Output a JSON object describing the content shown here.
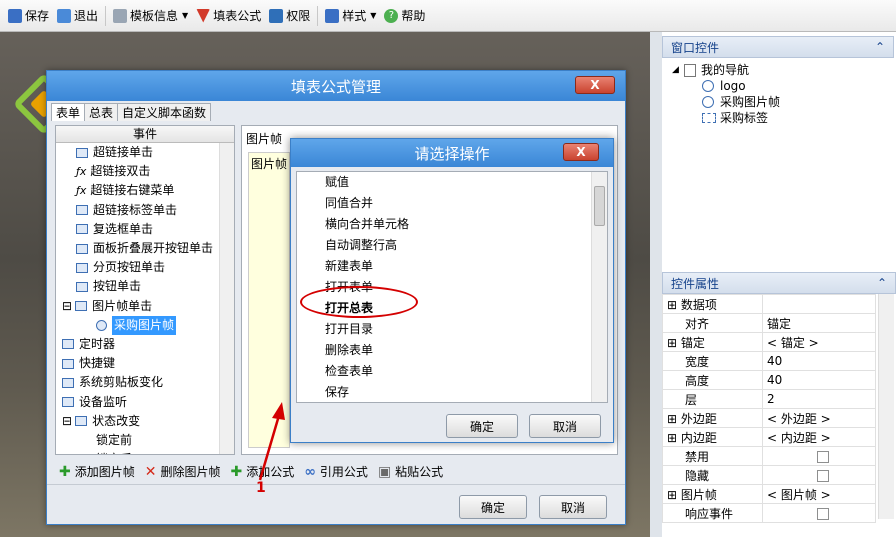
{
  "toolbar": {
    "save": "保存",
    "exit": "退出",
    "template_info": "模板信息",
    "fill_formula": "填表公式",
    "permission": "权限",
    "style": "样式",
    "help": "帮助"
  },
  "right_panel": {
    "window_controls_title": "窗口控件",
    "nav_root": "我的导航",
    "nav_children": [
      "logo",
      "采购图片帧",
      "采购标签"
    ],
    "props_title": "控件属性",
    "props": [
      {
        "k": "数据项",
        "v": "",
        "expand": true
      },
      {
        "k": "对齐",
        "v": "锚定",
        "expand": false
      },
      {
        "k": "锚定",
        "v": "< 锚定 >",
        "expand": true
      },
      {
        "k": "宽度",
        "v": "40",
        "expand": false
      },
      {
        "k": "高度",
        "v": "40",
        "expand": false
      },
      {
        "k": "层",
        "v": "2",
        "expand": false
      },
      {
        "k": "外边距",
        "v": "< 外边距 >",
        "expand": true
      },
      {
        "k": "内边距",
        "v": "< 内边距 >",
        "expand": true
      },
      {
        "k": "禁用",
        "v": "",
        "checkbox": true,
        "expand": false
      },
      {
        "k": "隐藏",
        "v": "",
        "checkbox": true,
        "expand": false
      },
      {
        "k": "图片帧",
        "v": "< 图片帧 >",
        "expand": true
      },
      {
        "k": "响应事件",
        "v": "",
        "checkbox": true,
        "expand": false
      }
    ]
  },
  "main_dialog": {
    "title": "填表公式管理",
    "close": "X",
    "tabs": [
      "表单",
      "总表",
      "自定义脚本函数"
    ],
    "events_header": "事件",
    "events": [
      {
        "label": "超链接单击",
        "icon": "grid",
        "indent": 1
      },
      {
        "label": "超链接双击",
        "icon": "fx",
        "indent": 1
      },
      {
        "label": "超链接右键菜单",
        "icon": "fx",
        "indent": 1
      },
      {
        "label": "超链接标签单击",
        "icon": "grid",
        "indent": 1
      },
      {
        "label": "复选框单击",
        "icon": "grid",
        "indent": 1
      },
      {
        "label": "面板折叠展开按钮单击",
        "icon": "grid",
        "indent": 1
      },
      {
        "label": "分页按钮单击",
        "icon": "grid",
        "indent": 1
      },
      {
        "label": "按钮单击",
        "icon": "grid",
        "indent": 1
      },
      {
        "label": "图片帧单击",
        "icon": "grid",
        "indent": 0,
        "expanded": true
      },
      {
        "label": "采购图片帧",
        "icon": "play",
        "indent": 2,
        "selected": true
      },
      {
        "label": "定时器",
        "icon": "clock",
        "indent": 0
      },
      {
        "label": "快捷键",
        "icon": "link",
        "indent": 0
      },
      {
        "label": "系统剪贴板变化",
        "icon": "scissors",
        "indent": 0
      },
      {
        "label": "设备监听",
        "icon": "device",
        "indent": 0
      },
      {
        "label": "状态改变",
        "icon": "grid",
        "indent": 0,
        "expanded": true
      },
      {
        "label": "锁定前",
        "icon": "none",
        "indent": 2
      },
      {
        "label": "锁定后",
        "icon": "none",
        "indent": 2
      }
    ],
    "pic_panel_label": "图片帧",
    "pic_inner_label": "图片帧",
    "bottom_tools": [
      "添加图片帧",
      "删除图片帧",
      "添加公式",
      "引用公式",
      "粘贴公式"
    ],
    "ok": "确定",
    "cancel": "取消"
  },
  "sub_dialog": {
    "title": "请选择操作",
    "close": "X",
    "options": [
      "赋值",
      "同值合并",
      "横向合并单元格",
      "自动调整行高",
      "新建表单",
      "打开表单",
      "打开总表",
      "打开目录",
      "删除表单",
      "检查表单",
      "保存"
    ],
    "selected_index": 6,
    "ok": "确定",
    "cancel": "取消"
  },
  "annotation": "1",
  "colors": {
    "title_blue": "#3a86d6",
    "close_red": "#c9432f",
    "highlight_red": "#d40000",
    "selection_blue": "#3399ff",
    "yellow_panel": "#ffffde"
  }
}
